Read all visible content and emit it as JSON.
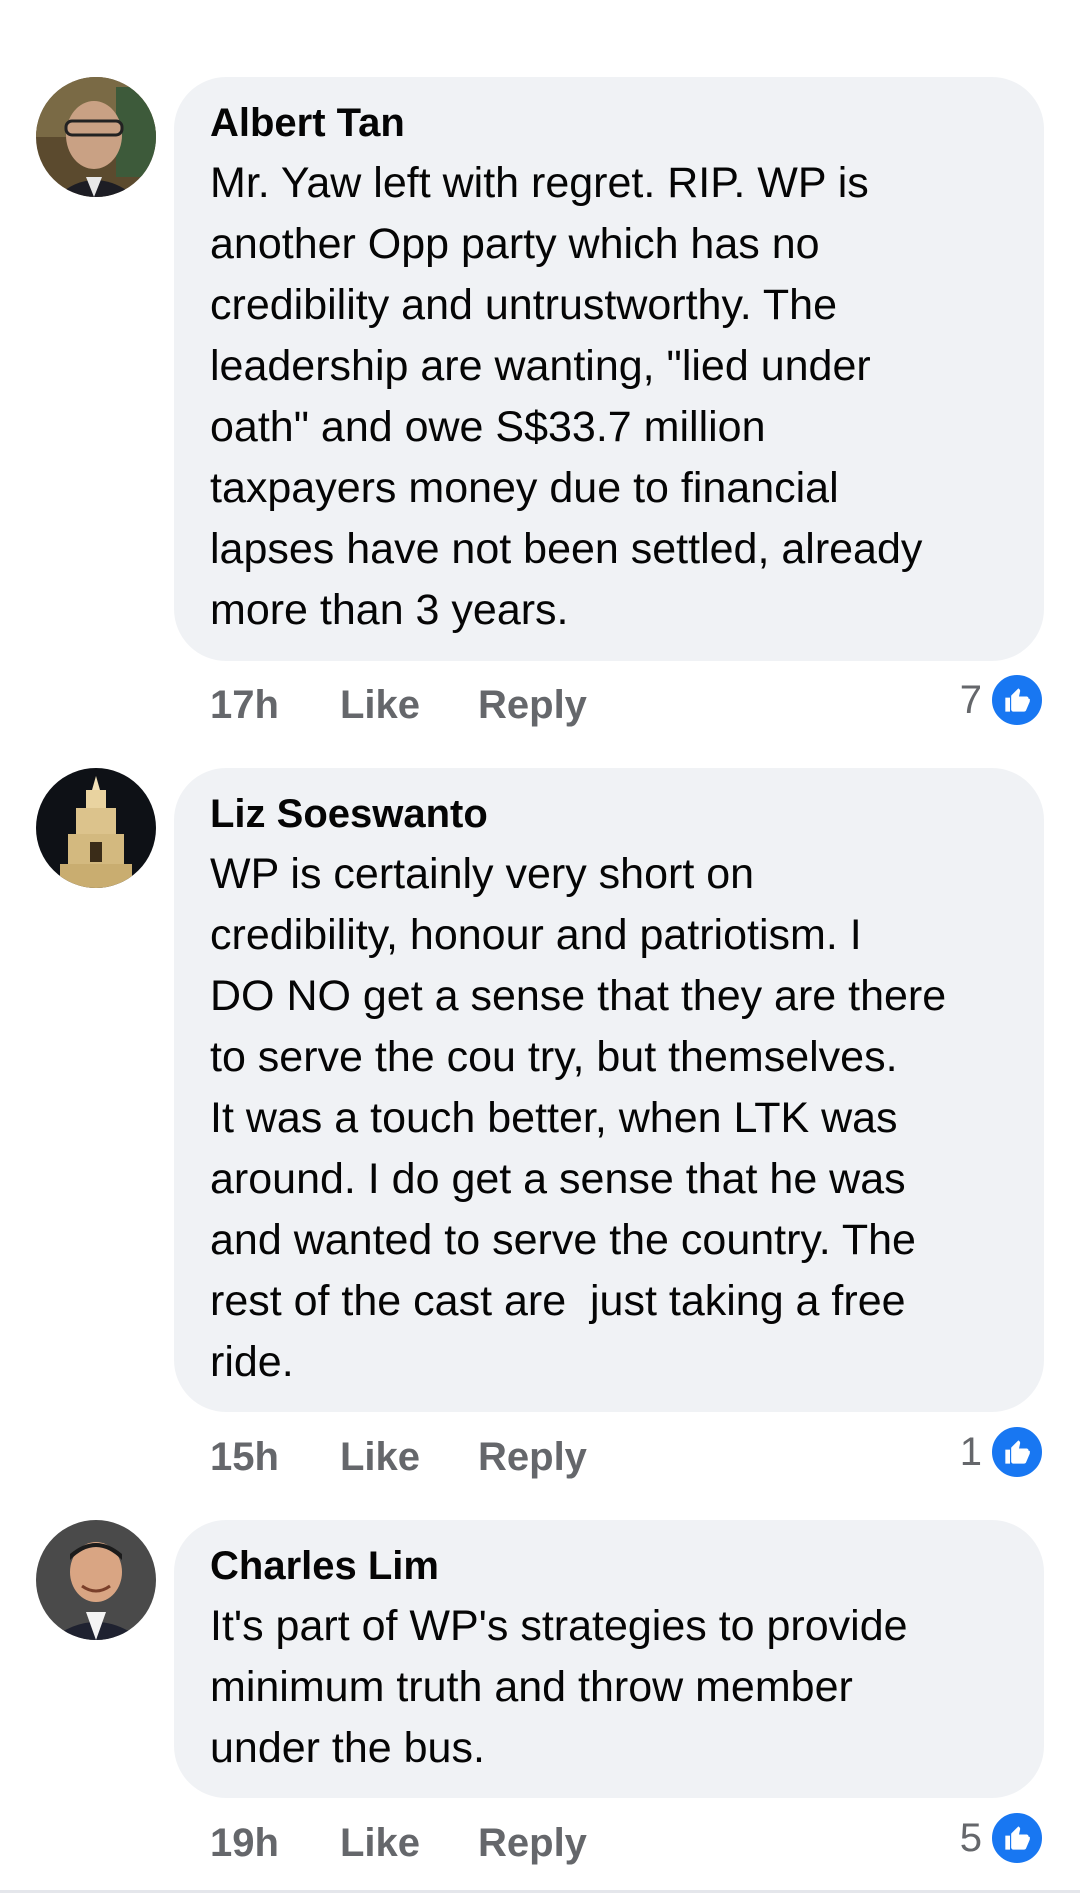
{
  "comments": [
    {
      "author": "Albert Tan",
      "avatar_icon": "profile-photo-icon",
      "text": "Mr. Yaw left with regret. RIP. WP is\nanother Opp party which has no\ncredibility and untrustworthy. The\nleadership are wanting, \"lied under\noath\" and owe S$33.7 million\ntaxpayers money due to financial\nlapses have not been settled, already\nmore than 3 years.",
      "time": "17h",
      "like_label": "Like",
      "reply_label": "Reply",
      "reaction_count": "7",
      "reaction_icon": "thumbs-up-icon"
    },
    {
      "author": "Liz Soeswanto",
      "avatar_icon": "profile-photo-icon",
      "text": "WP is certainly very short on\ncredibility, honour and patriotism. I\nDO NO get a sense that they are there\nto serve the cou try, but themselves.\nIt was a touch better, when LTK was\naround. I do get a sense that he was\nand wanted to serve the country. The\nrest of the cast are  just taking a free\nride.",
      "time": "15h",
      "like_label": "Like",
      "reply_label": "Reply",
      "reaction_count": "1",
      "reaction_icon": "thumbs-up-icon"
    },
    {
      "author": "Charles Lim",
      "avatar_icon": "profile-photo-icon",
      "text": "It's part of WP's strategies to provide\nminimum truth and throw member\nunder the bus.",
      "time": "19h",
      "like_label": "Like",
      "reply_label": "Reply",
      "reaction_count": "5",
      "reaction_icon": "thumbs-up-icon"
    }
  ],
  "colors": {
    "bubble": "#f0f2f5",
    "meta_text": "#65676b",
    "like_blue": "#1877f2"
  }
}
